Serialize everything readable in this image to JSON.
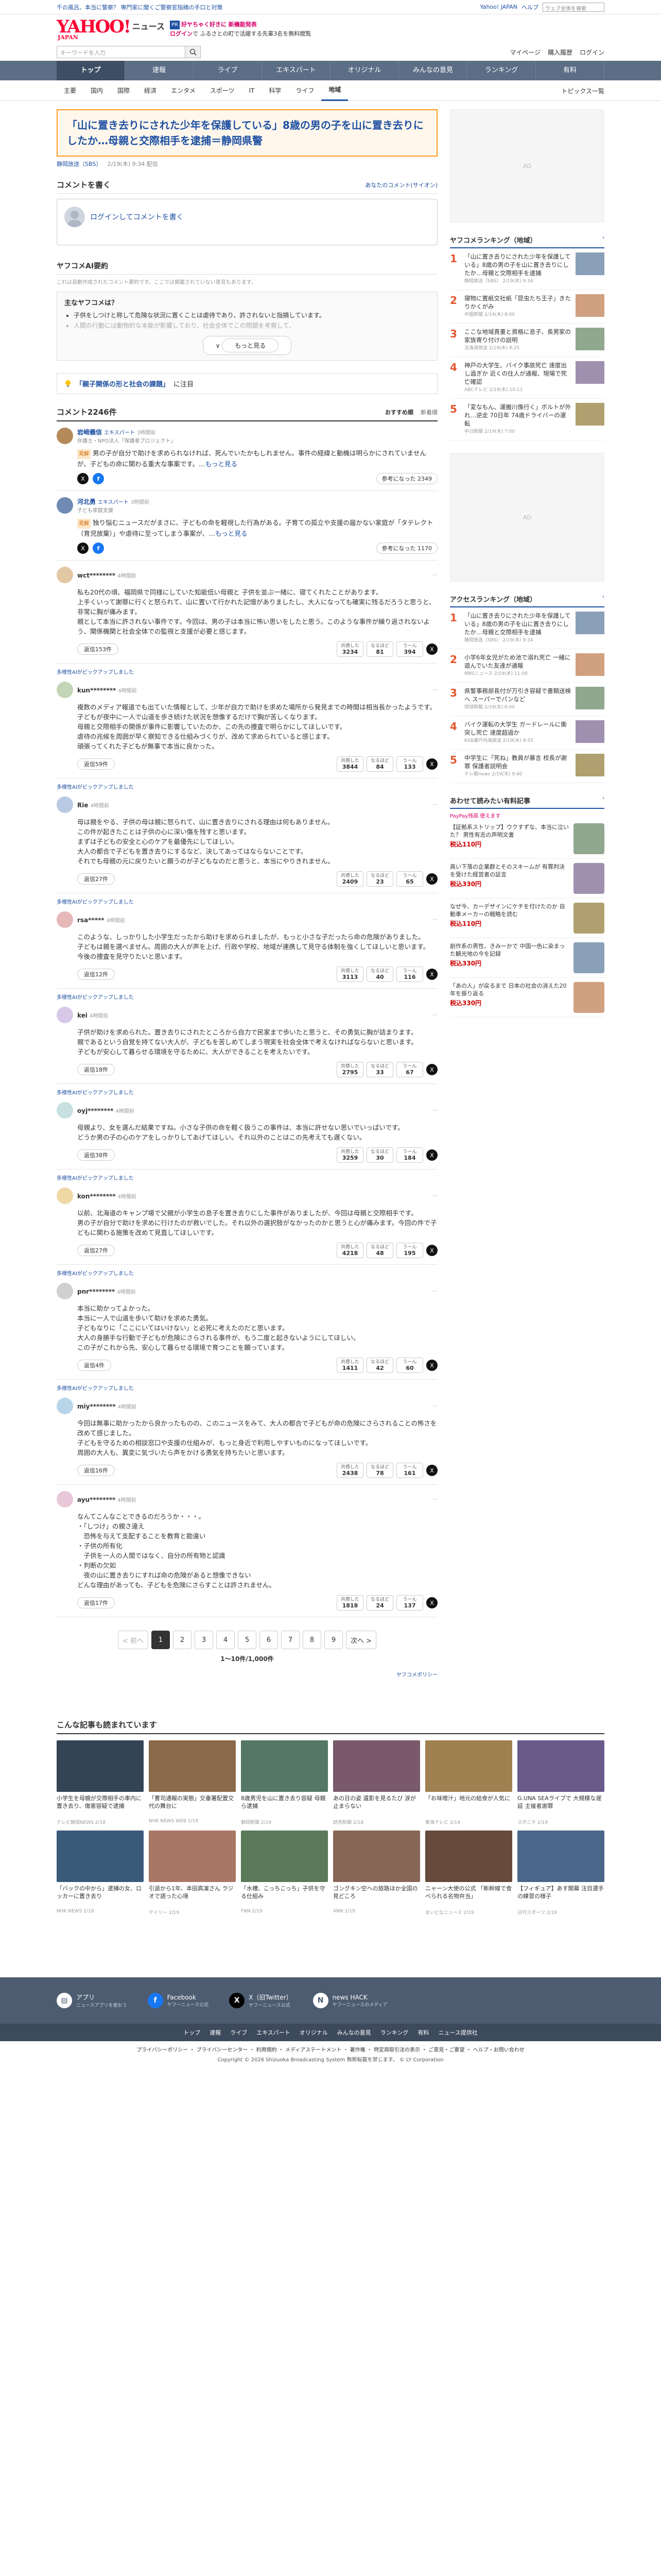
{
  "topline": {
    "alert": "千の風呂、本当に警察？ 専門家に聞くご警察官指摘の手口と対策",
    "links": [
      "Yahoo! JAPAN",
      "ヘルプ"
    ],
    "search_placeholder": "ウェブ全体を検索"
  },
  "header": {
    "logo": "YAHOO!",
    "logo_sub": "JAPAN",
    "service": "ニュース",
    "promo1_tag": "PR",
    "promo1": "好ヤちゃく好きに 新機能発表",
    "promo2": "ログイン",
    "promo2_text": "で ふるさとの町で活躍する先輩3名を無料閲覧"
  },
  "searchrow": {
    "placeholder": "キーワードを入力",
    "links": [
      "マイページ",
      "購入履歴",
      "ログイン"
    ]
  },
  "nav": [
    "トップ",
    "速報",
    "ライブ",
    "エキスパート",
    "オリジナル",
    "みんなの意見",
    "ランキング",
    "有料"
  ],
  "subnav": {
    "items": [
      "主要",
      "国内",
      "国際",
      "経済",
      "エンタメ",
      "スポーツ",
      "IT",
      "科学",
      "ライフ",
      "地域"
    ],
    "active": 9,
    "right": "トピックス一覧"
  },
  "article": {
    "title": "「山に置き去りにされた少年を保護している」8歳の男の子を山に置き去りにしたか…母親と交際相手を逮捕＝静岡県警",
    "source": "静岡放送（SBS）",
    "date": "2/19(木) 9:34 配信"
  },
  "comment_write": {
    "title": "コメントを書く",
    "link": "あなたのコメント(サイオン)",
    "login": "ログインしてコメントを書く"
  },
  "ai": {
    "title": "ヤフコメAI要約",
    "note": "これは自動作成されたコメント要約です。ここでは掲載されていない意見もあります。",
    "box_title": "主なヤフコメは？",
    "bullets": [
      "子供をしつけと称して危険な状況に置くことは虐待であり、許されないと指摘しています。",
      "人間の行動には動物的な本能が影響しており、社会全体でこの問題を考察して、"
    ],
    "more": "もっと見る"
  },
  "topic": {
    "label": "「親子関係の形と社会の課題」",
    "suffix": "に注目"
  },
  "comments_head": {
    "title": "コメント2246件",
    "sort": [
      "おすすめ順",
      "新着順"
    ]
  },
  "experts": [
    {
      "name": "岩﨑義信",
      "badge": "エキスパート",
      "time": "3時間前",
      "role": "弁護士・NPO法人「保護者プロジェクト」",
      "hl": "見解",
      "body": "男の子が自分で助けを求められなければ、死んでいたかもしれません。事件の経緯と動機は明らかにされていませんが、子どもの命に関わる重大な事案です。…",
      "more": "もっと見る",
      "agree": "参考になった 2349"
    },
    {
      "name": "河北勇",
      "badge": "エキスパート",
      "time": "3時間前",
      "role": "子ども家庭支援",
      "hl": "見解",
      "body": "独り悩むニュースだがまさに、子どもの命を軽視した行為がある。子育ての孤立や支援の届かない家庭が「タテレクト（育児放棄）」や虐待に至ってしまう事案が、…",
      "more": "もっと見る",
      "agree": "参考になった 1170"
    }
  ],
  "comments": [
    {
      "user": "wct********",
      "time": "4時間前",
      "body": "私も20代の頃、福岡県で同様にしていた知能低い母親と 子供を並ぶ一緒に、寝てくれたことがあります。\n上手くいって謝罪に行くと怒られて、山に置いて行かれた記憶がありましたし、大人になっても確実に残るだろうと思うと、非常に胸が痛みます。\n親として本当に許されない事件です。今回は、男の子は本当に怖い思いをしたと思う。このような事件が繰り返されないよう、関係機関と社会全体での監視と支援が必要と感じます。",
      "reply": "返信153件",
      "r": [
        "共感した\n3234",
        "なるほど\n81",
        "うーん\n394"
      ]
    },
    {
      "user": "kun********",
      "time": "4時間前",
      "body": "複数のメディア報道でも出ていた情報として、少年が自力で助けを求めた場所から発見までの時間は相当長かったようです。\n子どもが夜中に一人で山道を歩き続けた状況を想像するだけで胸が苦しくなります。\n母親と交際相手の関係が事件に影響していたのか、この先の捜査で明らかにしてほしいです。\n虐待の兆候を周囲が早く察知できる仕組みづくりが、改めて求められていると感じます。\n頑張ってくれた子どもが無事で本当に良かった。",
      "reply": "返信59件",
      "r": [
        "共感した\n3844",
        "なるほど\n84",
        "うーん\n133"
      ]
    },
    {
      "user": "Rie",
      "time": "4時間前",
      "body": "母は親をやる、子供の母は親に怒られて、山に置き去りにされる理由は何もありません。\nこの件が起きたことは子供の心に深い傷を残すと思います。\nまずは子どもの安全と心のケアを最優先にしてほしい。\n大人の都合で子どもを置き去りにするなど、決してあってはならないことです。\nそれでも母親の元に戻りたいと願うのが子どもなのだと思うと、本当にやりきれません。",
      "reply": "返信27件",
      "r": [
        "共感した\n2409",
        "なるほど\n23",
        "うーん\n65"
      ]
    },
    {
      "user": "rsa*****",
      "time": "4時間前",
      "body": "このような、しっかりした小学生だったから助けを求められましたが、もっと小さな子だったら命の危険がありました。\n子どもは親を選べません。周囲の大人が声を上げ、行政や学校、地域が連携して見守る体制を強くしてほしいと思います。\n今後の捜査を見守りたいと思います。",
      "reply": "返信12件",
      "r": [
        "共感した\n3113",
        "なるほど\n40",
        "うーん\n116"
      ]
    },
    {
      "user": "kei",
      "time": "4時間前",
      "body": "子供が助けを求められた。置き去りにされたところから自力で民家まで歩いたと思うと、その勇気に胸が詰まります。\n親であるという自覚を持てない大人が、子どもを苦しめてしまう現実を社会全体で考えなければならないと思います。\n子どもが安心して暮らせる環境を守るために、大人ができることを考えたいです。",
      "reply": "返信18件",
      "r": [
        "共感した\n2795",
        "なるほど\n33",
        "うーん\n67"
      ]
    },
    {
      "user": "oyj********",
      "time": "4時間前",
      "body": "母親より、女を選んだ結果ですね。小さな子供の命を軽く扱うこの事件は、本当に許せない思いでいっぱいです。\nどうか男の子の心のケアをしっかりしてあげてほしい。それ以外のことはこの先考えても遅くない。",
      "reply": "返信38件",
      "r": [
        "共感した\n3259",
        "なるほど\n30",
        "うーん\n184"
      ]
    },
    {
      "user": "kon********",
      "time": "4時間前",
      "body": "以前、北海道のキャンプ場で父親が小学生の息子を置き去りにした事件がありましたが、今回は母親と交際相手です。\n男の子が自分で助けを求めに行けたのが救いでした。それ以外の選択肢がなかったのかと思うと心が痛みます。今回の件で子どもに関わる施策を改めて見直してほしいです。",
      "reply": "返信27件",
      "r": [
        "共感した\n4218",
        "なるほど\n48",
        "うーん\n195"
      ]
    },
    {
      "user": "pnr********",
      "time": "4時間前",
      "body": "本当に助かってよかった。\n本当に一人で山道を歩いて助けを求めた勇気。\n子どもなりに「ここにいてはいけない」と必死に考えたのだと思います。\n大人の身勝手な行動で子どもが危険にさらされる事件が、もう二度と起きないようにしてほしい。\nこの子がこれから先、安心して暮らせる環境で育つことを願っています。",
      "reply": "返信4件",
      "r": [
        "共感した\n1411",
        "なるほど\n42",
        "うーん\n60"
      ]
    },
    {
      "user": "miy********",
      "time": "4時間前",
      "body": "今回は無事に助かったから良かったものの、このニュースをみて、大人の都合で子どもが命の危険にさらされることの怖さを改めて感じました。\n子どもを守るための相談窓口や支援の仕組みが、もっと身近で利用しやすいものになってほしいです。\n周囲の大人も、異変に気づいたら声をかける勇気を持ちたいと思います。",
      "reply": "返信16件",
      "r": [
        "共感した\n2438",
        "なるほど\n78",
        "うーん\n161"
      ]
    },
    {
      "user": "ayu********",
      "time": "4時間前",
      "body": "なんてこんなことできるのだろうか・・・。\n・「しつけ」の親さ違え\n　恐怖を与えて支配することを教育と勘違い\n・子供の所有化\n　子供を一人の人間ではなく、自分の所有物と認識\n・判断の欠如\n　夜の山に置き去りにすれば命の危険があると想像できない\nどんな理由があっても、子どもを危険にさらすことは許されません。",
      "reply": "返信17件",
      "r": [
        "共感した\n1818",
        "なるほど\n24",
        "うーん\n137"
      ]
    }
  ],
  "pickup": "多様性AIがピックアップしました",
  "pager": {
    "prev": "< 前へ",
    "pages": [
      "1",
      "2",
      "3",
      "4",
      "5",
      "6",
      "7",
      "8",
      "9"
    ],
    "next": "次へ >",
    "count": "1〜10件/1,000件",
    "yc": "ヤフコメポリシー"
  },
  "side": {
    "rank1_title": "ヤフコメランキング（地域）",
    "rank1": [
      {
        "t": "「山に置き去りにされた少年を保護している」8歳の男の子を山に置き去りにしたか…母親と交際相手を逮捕",
        "d": "静岡放送（SBS） 2/19(木) 9:34"
      },
      {
        "t": "寝物に置紙交社紙「昆虫たち王子」きたりかくがみ",
        "d": "中国新聞 2/19(木) 8:00"
      },
      {
        "t": "ここな地域貴重と資格に息子、長男家の家族寄り付けの説明",
        "d": "北海道放送 2/19(木) 8:25"
      },
      {
        "t": "神戸の大学生、バイク事故死亡 速度出し過ぎか 近くの住人が通報、現場で死亡確認",
        "d": "ABCテレビ 2/19(木) 10:11"
      },
      {
        "t": "「変なもん、運搬川像行く」ボルトが外れ…逆走 70日年 74歳ドライバーの運転",
        "d": "中日新聞 2/19(木) 7:00"
      }
    ],
    "rank2_title": "アクセスランキング（地域）",
    "rank2": [
      {
        "t": "「山に置き去りにされた少年を保護している」8歳の男の子を山に置き去りにしたか…母親と交際相手を逮捕",
        "d": "静岡放送（SBS） 2/19(木) 9:34"
      },
      {
        "t": "小学6年女児がため池で溺れ死亡 一緒に遊んでいた友達が通報",
        "d": "MBSニュース 2/19(木) 11:00"
      },
      {
        "t": "県警事務部長付が万引き容疑で書類送検へ スーパーでパンなど",
        "d": "琉球新報 2/19(木) 6:00"
      },
      {
        "t": "バイク運転の大学生 ガードレールに衝突し死亡 速度超過か",
        "d": "KSB瀬戸内海放送 2/19(木) 8:55"
      },
      {
        "t": "中学生に「死ね」教員が暴言 校長が謝罪 保護者説明会",
        "d": "テレ朝news 2/19(木) 9:40"
      }
    ],
    "buy_title": "あわせて読みたい有料記事",
    "buy_sub": "PayPay残高 使えます",
    "buy": [
      {
        "t": "【証拠系ストリップ】ウクすずな、本当に泣いた？ 男性有志の声明文書",
        "p": "税込110円"
      },
      {
        "t": "高い下落の企業群とそのスキームが 有罪判決を受けた経営者の証言",
        "p": "税込330円"
      },
      {
        "t": "なぜ今、カーデザインにケチを付けたのか 自動車メーカーの戦略を読む",
        "p": "税込110円"
      },
      {
        "t": "創作系の男性、きみーかで 中国一色に染まった観光地の今を記録",
        "p": "税込330円"
      },
      {
        "t": "「あの人」が戻るまで 日本の社会の消えた20年を振り返る",
        "p": "税込330円"
      }
    ]
  },
  "recent": {
    "title": "こんな記事も読まれています",
    "cards": [
      {
        "t": "小学生を母親が交際相手の車内に置き去り、傷害容疑で逮捕",
        "s": "テレビ静岡NEWS 2/18"
      },
      {
        "t": "「曹司通報の実態」交番署配置交代の舞台に",
        "s": "NHK NEWS WEB 2/19"
      },
      {
        "t": "8歳男児を山に置き去り容疑 母親ら逮捕",
        "s": "静岡新聞 2/19"
      },
      {
        "t": "あの日の姿 遺影を見るたび 涙が止まらない",
        "s": "読売新聞 2/18"
      },
      {
        "t": "「お味噌汁」地元の給食が人気に",
        "s": "東海テレビ 2/19"
      },
      {
        "t": "G.UNA SEAライブで 大規模な遅延 主催者謝罪",
        "s": "スポニチ 2/19"
      },
      {
        "t": "「バックの中から」逮捕の女、ロッカーに置き去り",
        "s": "NHK NEWS 2/18"
      },
      {
        "t": "引退から1年、本田真凜さん ラジオで語った心境",
        "s": "デイリー 2/19"
      },
      {
        "t": "「水槽、こっちこっち」子供を守る仕組み",
        "s": "FNN 2/19"
      },
      {
        "t": "ゴングキン空への旅路ほか全国の見どころ",
        "s": "ANN 2/19"
      },
      {
        "t": "ニャーン大使の公式 「新幹線で食べられる名物弁当」",
        "s": "まいどなニュース 2/19"
      },
      {
        "t": "【フィギュア】あす開幕 注目選手の練習の様子",
        "s": "日刊スポーツ 2/19"
      }
    ]
  },
  "footer": {
    "items": [
      {
        "t": "アプリ",
        "s": "ニュースアプリを使おう"
      },
      {
        "t": "Facebook",
        "s": "ヤフーニュース公式"
      },
      {
        "t": "X（旧Twitter）",
        "s": "ヤフーニュース公式"
      },
      {
        "t": "news HACK",
        "s": "ヤフーニュースのメディア"
      }
    ],
    "nav": [
      "トップ",
      "速報",
      "ライブ",
      "エキスパート",
      "オリジナル",
      "みんなの意見",
      "ランキング",
      "有料",
      "ニュース提供社"
    ],
    "legal": "プライバシーポリシー ・ プライバシーセンター ・ 利用規約 ・ メディアステートメント ・ 著作権 ・ 特定商取引法の表示 ・ ご意見・ご要望 ・ ヘルプ・お問い合わせ",
    "copy": "Copyright © 2026 Shizuoka Broadcasting System 無断転載を禁じます。 © LY Corporation"
  },
  "colors": {
    "accent": "#1e50a2",
    "nav": "#5b6e86",
    "title_border": "#ff9a1f",
    "brand": "#ff0033"
  }
}
